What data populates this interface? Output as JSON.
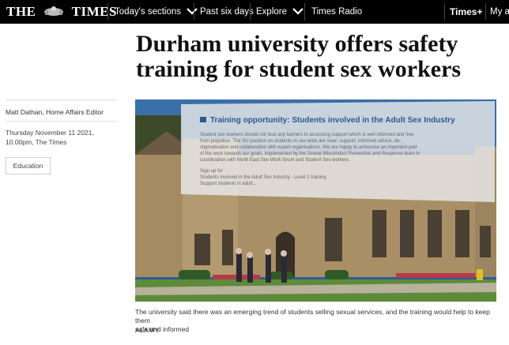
{
  "header": {
    "logo_left": "THE",
    "logo_right": "TIMES",
    "nav": {
      "todays_sections": "Today's sections",
      "past_six_days": "Past six days",
      "explore": "Explore",
      "times_radio": "Times Radio"
    },
    "times_plus": "Times+",
    "my_account": "My a"
  },
  "article": {
    "headline_line1": "Durham university offers safety",
    "headline_line2": "training for student sex workers",
    "author": "Matt Dathan, Home Affairs Editor",
    "date_line1": "Thursday November 11 2021,",
    "date_line2": "10.00pm, The Times",
    "tag": "Education",
    "image": {
      "overlay_title": "Training opportunity: Students involved in the Adult Sex Industry",
      "overlay_body": [
        "Student sex workers should not face any barriers to accessing support which is well informed and free",
        "from prejudice. The SU position on students in sex work are clear: support, informed advice, de-",
        "stigmatisation and collaboration with expert organisations. We are happy to announce an important part",
        "of the work towards our goals, implemented by the Sexual Misconduct Prevention and Response team in",
        "coordination with North East Sex Work forum and Student Sex workers."
      ],
      "overlay_signup": [
        "Sign up for",
        "Students involved in the Adult Sex Industry - Level 1 training",
        "Support students in adult..."
      ]
    },
    "caption_line1": "The university said there was an emerging trend of students selling sexual services, and the training would help to keep them",
    "caption_line2": "safe and informed",
    "credit": "ALAMY"
  },
  "colors": {
    "topbar": "#000000",
    "text": "#111111"
  }
}
